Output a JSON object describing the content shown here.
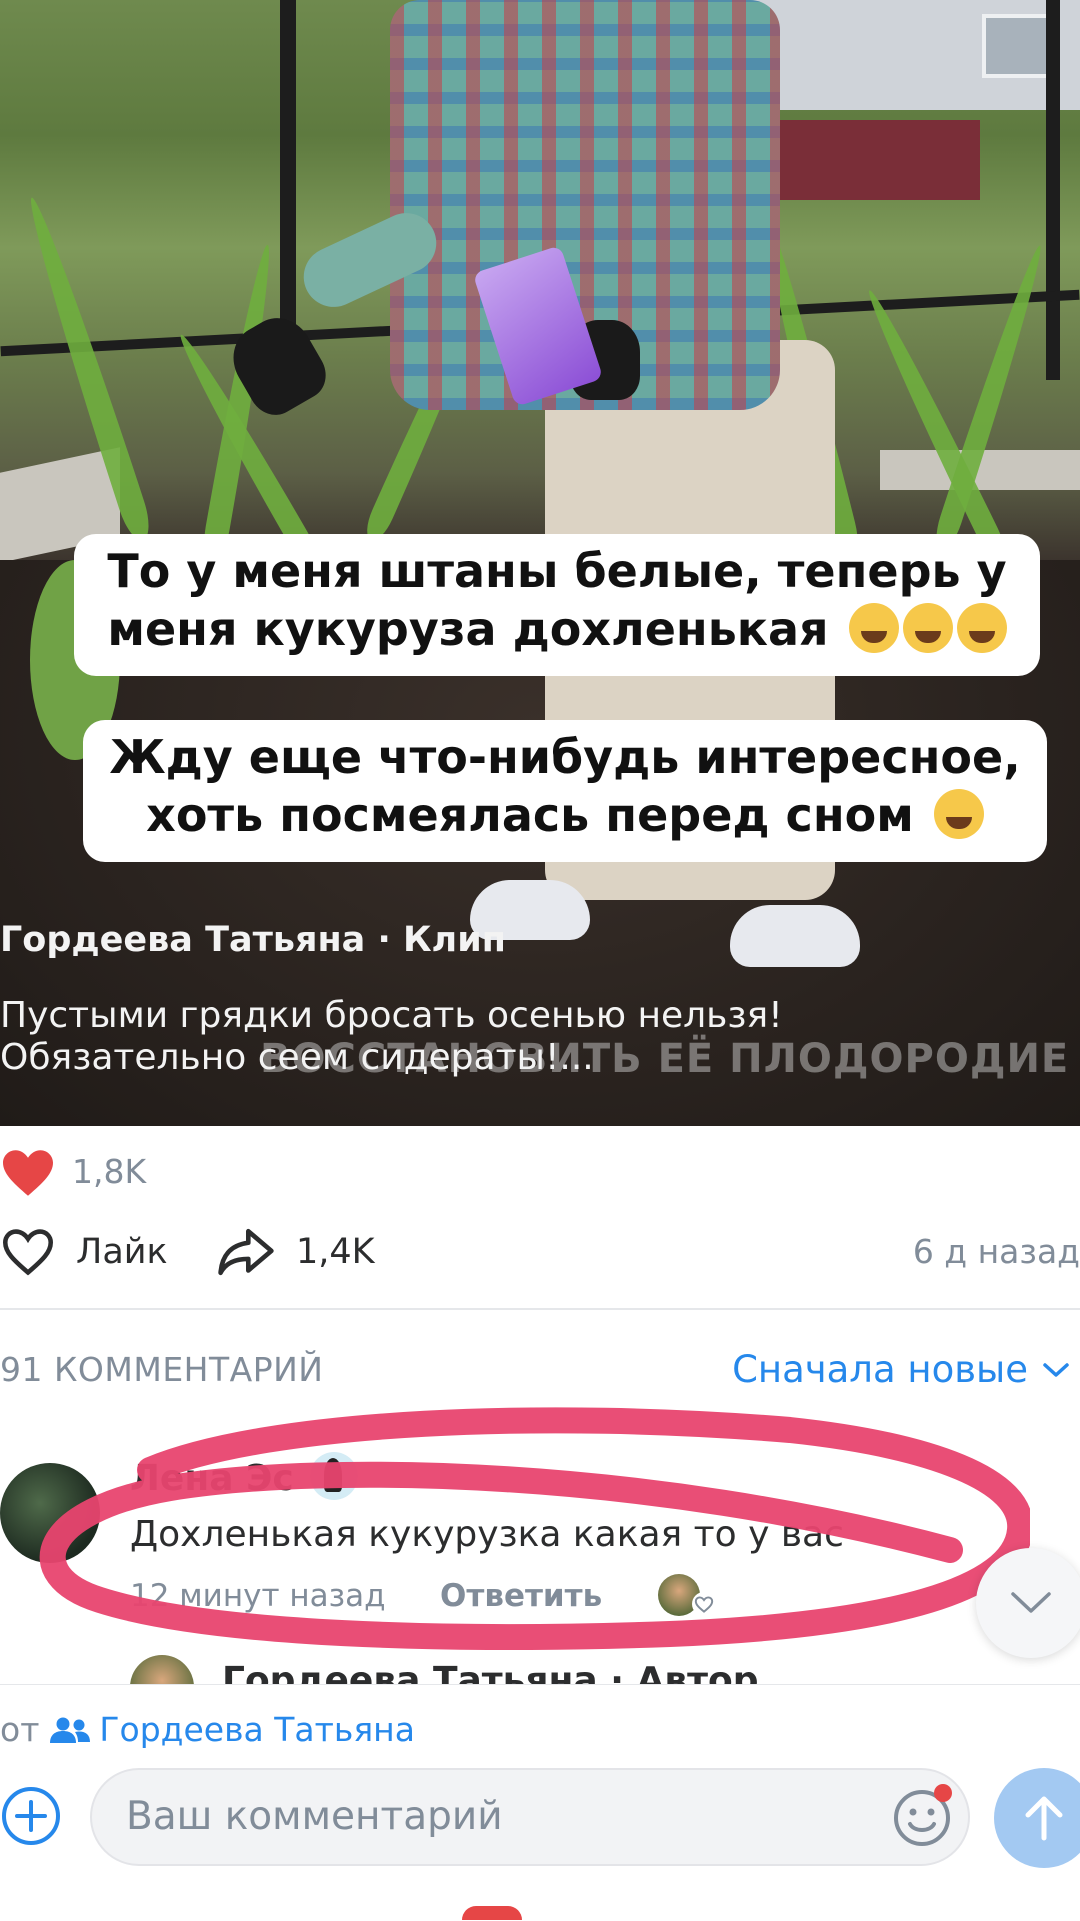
{
  "video": {
    "captions": [
      "То у меня штаны белые, теперь у меня кукуруза дохленькая",
      "Жду еще что-нибудь интересное, хоть посмеялась перед сном"
    ],
    "author_line": "Гордеева Татьяна · Клип",
    "description": "Пустыми грядки бросать осенью нельзя! Обязательно сеем сидераты!...",
    "overlay_text": "ВОССТАНОВИТЬ ЕЁ ПЛОДОРОДИЕ"
  },
  "reactions": {
    "likes_count": "1,8K",
    "like_label": "Лайк",
    "share_count": "1,4K",
    "time_ago": "6 д назад"
  },
  "comments": {
    "count_label": "91 КОММЕНТАРИЙ",
    "sort_label": "Сначала новые",
    "items": [
      {
        "name": "Лена Эс",
        "text": "Дохленькая кукурузка какая то у вас",
        "time": "12 минут назад",
        "reply_label": "Ответить"
      },
      {
        "name": "Гордеева Татьяна · Автор"
      }
    ]
  },
  "composer": {
    "from_prefix": "от",
    "from_name": "Гордеева Татьяна",
    "placeholder": "Ваш комментарий"
  },
  "colors": {
    "accent": "#2688eb",
    "highlight": "#e8456f",
    "muted": "#818c99",
    "heart": "#e64646"
  }
}
